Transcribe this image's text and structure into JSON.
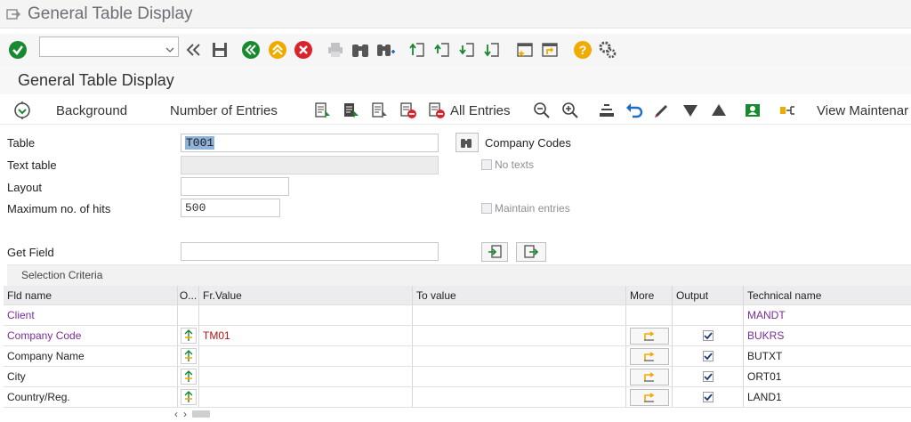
{
  "window": {
    "title": "General Table Display"
  },
  "app": {
    "title": "General Table Display"
  },
  "toolbar2": {
    "background": "Background",
    "number_of_entries": "Number of Entries",
    "all_entries": "All Entries",
    "view_maintenance": "View Maintenar"
  },
  "form": {
    "table_label": "Table",
    "table_value": "T001",
    "text_table_label": "Text table",
    "layout_label": "Layout",
    "max_hits_label": "Maximum no. of hits",
    "max_hits_value": "500",
    "get_field_label": "Get Field",
    "company_codes": "Company Codes",
    "no_texts": "No texts",
    "maintain_entries": "Maintain entries"
  },
  "selection": {
    "header": "Selection Criteria",
    "columns": [
      "Fld name",
      "O...",
      "Fr.Value",
      "To value",
      "More",
      "Output",
      "Technical name"
    ],
    "rows": [
      {
        "fld": "Client",
        "from": "",
        "tech": "MANDT"
      },
      {
        "fld": "Company Code",
        "from": "TM01",
        "tech": "BUKRS"
      },
      {
        "fld": "Company Name",
        "from": "",
        "tech": "BUTXT"
      },
      {
        "fld": "City",
        "from": "",
        "tech": "ORT01"
      },
      {
        "fld": "Country/Reg.",
        "from": "",
        "tech": "LAND1"
      }
    ]
  },
  "colors": {
    "key_field": "#7b2d99",
    "value_red": "#b41212",
    "ok_green": "#17892f",
    "cancel_red": "#d9242b",
    "nav_yellow": "#f0ab00"
  }
}
